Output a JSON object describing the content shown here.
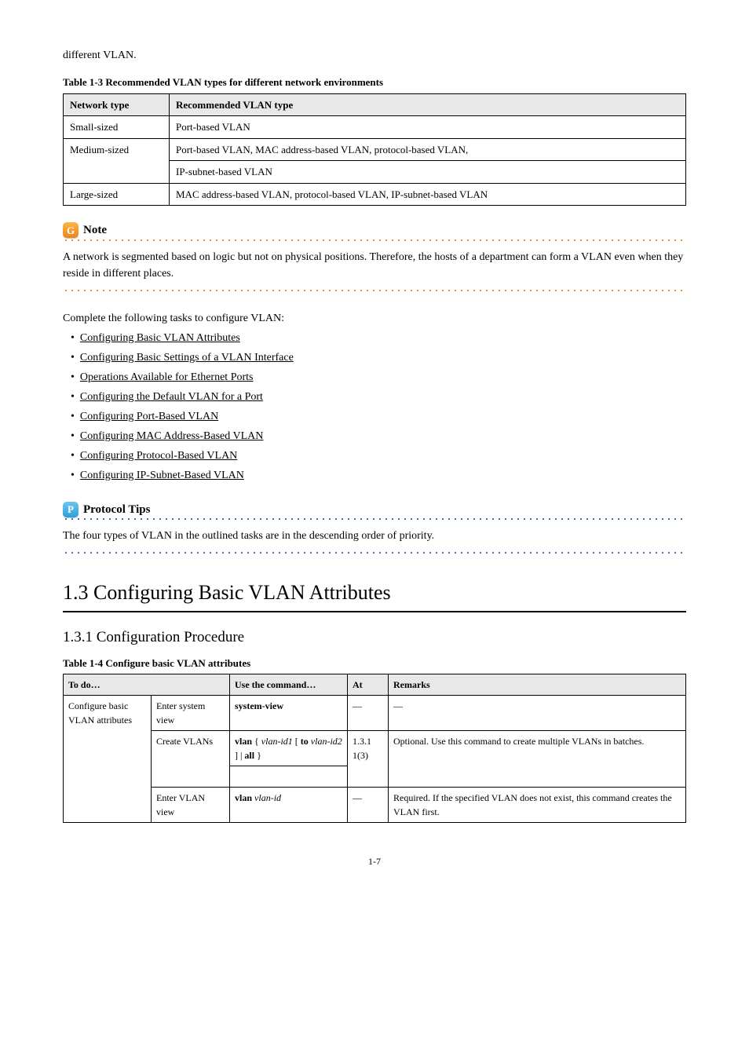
{
  "intro": "different VLAN.",
  "table1": {
    "caption": "Table 1-3 Recommended VLAN types for different network environments",
    "head": [
      "Network type",
      "Recommended VLAN type"
    ],
    "rows": [
      [
        "Small-sized",
        "Port-based VLAN"
      ],
      [
        "",
        "Port-based VLAN, MAC address-based VLAN, protocol-based VLAN,"
      ],
      [
        "Medium-sized",
        "IP-subnet-based VLAN"
      ],
      [
        "Large-sized",
        "MAC address-based VLAN, protocol-based VLAN, IP-subnet-based VLAN"
      ]
    ]
  },
  "note": {
    "label": "Note",
    "body": "A network is segmented based on logic but not on physical positions. Therefore, the hosts of a department can form a VLAN even when they reside in different places."
  },
  "outline": {
    "lead": "Complete the following tasks to configure VLAN:",
    "items": [
      "Configuring Basic VLAN Attributes",
      "Configuring Basic Settings of a VLAN Interface",
      "Operations Available for Ethernet Ports",
      "Configuring the Default VLAN for a Port",
      "Configuring Port-Based VLAN",
      "Configuring MAC Address-Based VLAN",
      "Configuring Protocol-Based VLAN",
      "Configuring IP-Subnet-Based VLAN"
    ]
  },
  "protocol_tips": {
    "label": "Protocol Tips",
    "body": "The four types of VLAN in the outlined tasks are in the descending order of priority."
  },
  "section_title": "1.3  Configuring Basic VLAN Attributes",
  "sub1": {
    "title": "1.3.1  Configuration Procedure",
    "caption": "Table 1-4 Configure basic VLAN attributes",
    "head": [
      "To do…",
      "Use the command…",
      "At",
      "Remarks"
    ],
    "group_label": "Configure basic VLAN attributes",
    "rows": [
      [
        "Enter system view",
        "system-view",
        "—",
        "—"
      ],
      [
        "Create VLANs",
        "vlan { vlan-id1 [ to vlan-id2 ] | all }",
        "",
        "Optional. Use this command to create multiple VLANs in batches."
      ],
      [
        "",
        "",
        "1.3.1  1(3)",
        ""
      ],
      [
        "Enter VLAN view",
        "vlan vlan-id",
        "—",
        "Required. If the specified VLAN does not exist, this command creates the VLAN first."
      ]
    ]
  },
  "page_number": "1-7"
}
